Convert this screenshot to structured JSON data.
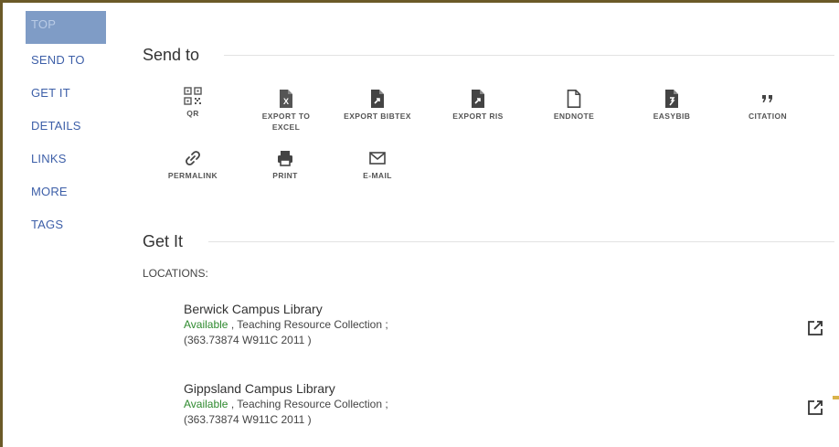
{
  "nav": {
    "items": [
      {
        "label": "TOP"
      },
      {
        "label": "SEND TO"
      },
      {
        "label": "GET IT"
      },
      {
        "label": "DETAILS"
      },
      {
        "label": "LINKS"
      },
      {
        "label": "MORE"
      },
      {
        "label": "TAGS"
      }
    ]
  },
  "send_to": {
    "title": "Send to",
    "actions": [
      {
        "label": "QR",
        "icon": "qr-code-icon"
      },
      {
        "label": "EXPORT TO EXCEL",
        "icon": "excel-file-icon"
      },
      {
        "label": "EXPORT BIBTEX",
        "icon": "export-file-icon"
      },
      {
        "label": "EXPORT RIS",
        "icon": "export-file-icon"
      },
      {
        "label": "ENDNOTE",
        "icon": "document-icon"
      },
      {
        "label": "EASYBIB",
        "icon": "easybib-file-icon"
      },
      {
        "label": "CITATION",
        "icon": "quote-icon"
      },
      {
        "label": "PERMALINK",
        "icon": "link-icon"
      },
      {
        "label": "PRINT",
        "icon": "printer-icon"
      },
      {
        "label": "E-MAIL",
        "icon": "envelope-icon"
      }
    ]
  },
  "get_it": {
    "title": "Get It",
    "locations_label": "LOCATIONS:",
    "locations": [
      {
        "name": "Berwick Campus Library",
        "availability": "Available",
        "collection": " , Teaching Resource Collection ;",
        "call_number": "(363.73874 W911C 2011 )"
      },
      {
        "name": "Gippsland Campus Library",
        "availability": "Available",
        "collection": " , Teaching Resource Collection ;",
        "call_number": "(363.73874 W911C 2011 )"
      }
    ]
  },
  "colors": {
    "nav_link": "#3d5fa8",
    "nav_active_bg": "#7f9cc6",
    "available": "#2f8a2f",
    "frame_border": "#6b5a28"
  }
}
